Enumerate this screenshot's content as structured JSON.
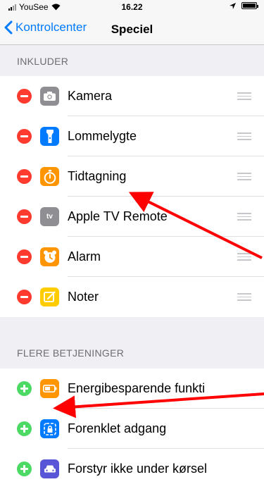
{
  "status": {
    "carrier": "YouSee",
    "time": "16.22"
  },
  "nav": {
    "back_label": "Kontrolcenter",
    "title": "Speciel"
  },
  "include": {
    "header": "INKLUDER",
    "items": [
      {
        "label": "Kamera",
        "icon": "camera-icon",
        "color": "#8e8e93"
      },
      {
        "label": "Lommelygte",
        "icon": "flashlight-icon",
        "color": "#007aff"
      },
      {
        "label": "Tidtagning",
        "icon": "stopwatch-icon",
        "color": "#ff9500"
      },
      {
        "label": "Apple TV Remote",
        "icon": "appletv-icon",
        "color": "#8e8e93",
        "icon_text": "tv"
      },
      {
        "label": "Alarm",
        "icon": "alarm-clock-icon",
        "color": "#ff9500"
      },
      {
        "label": "Noter",
        "icon": "notes-icon",
        "color": "#ffcc00"
      }
    ]
  },
  "more": {
    "header": "FLERE BETJENINGER",
    "items": [
      {
        "label": "Energibesparende funkti",
        "icon": "battery-icon",
        "color": "#ff9500"
      },
      {
        "label": "Forenklet adgang",
        "icon": "guided-access-icon",
        "color": "#007aff"
      },
      {
        "label": "Forstyr ikke under kørsel",
        "icon": "car-icon",
        "color": "#5856d6"
      }
    ]
  },
  "annotation_color": "#ff0000"
}
